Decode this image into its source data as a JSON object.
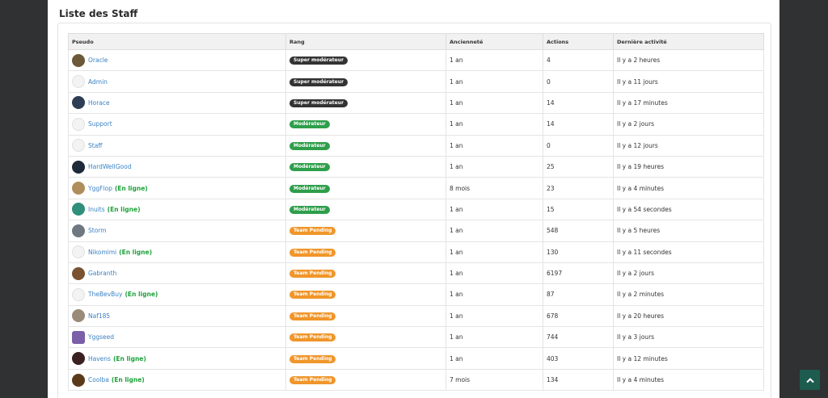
{
  "page": {
    "title": "Liste des Staff"
  },
  "table": {
    "headers": [
      "Pseudo",
      "Rang",
      "Ancienneté",
      "Actions",
      "Dernière activité"
    ],
    "online_label": "(En ligne)",
    "rows": [
      {
        "name": "Oracle",
        "online": false,
        "rank": "Super modérateur",
        "rank_color": "#333333",
        "seniority": "1 an",
        "actions": "4",
        "last": "Il y a 2 heures",
        "avatar": "#6b5a3a",
        "avatar_style": "round"
      },
      {
        "name": "Admin",
        "online": false,
        "rank": "Super modérateur",
        "rank_color": "#333333",
        "seniority": "1 an",
        "actions": "0",
        "last": "Il y a 11 jours",
        "avatar": "default",
        "avatar_style": "round"
      },
      {
        "name": "Horace",
        "online": false,
        "rank": "Super modérateur",
        "rank_color": "#333333",
        "seniority": "1 an",
        "actions": "14",
        "last": "Il y a 17 minutes",
        "avatar": "#2d3e55",
        "avatar_style": "round"
      },
      {
        "name": "Support",
        "online": false,
        "rank": "Modérateur",
        "rank_color": "#2e9e4a",
        "seniority": "1 an",
        "actions": "14",
        "last": "Il y a 2 jours",
        "avatar": "default",
        "avatar_style": "round"
      },
      {
        "name": "Staff",
        "online": false,
        "rank": "Modérateur",
        "rank_color": "#2e9e4a",
        "seniority": "1 an",
        "actions": "0",
        "last": "Il y a 12 jours",
        "avatar": "default",
        "avatar_style": "round"
      },
      {
        "name": "HardWellGood",
        "online": false,
        "rank": "Modérateur",
        "rank_color": "#2e9e4a",
        "seniority": "1 an",
        "actions": "25",
        "last": "Il y a 19 heures",
        "avatar": "#1d2a3a",
        "avatar_style": "round"
      },
      {
        "name": "YggFlop",
        "online": true,
        "rank": "Modérateur",
        "rank_color": "#2e9e4a",
        "seniority": "8 mois",
        "actions": "23",
        "last": "Il y a 4 minutes",
        "avatar": "#b08d5c",
        "avatar_style": "round"
      },
      {
        "name": "Inuits",
        "online": true,
        "rank": "Modérateur",
        "rank_color": "#2e9e4a",
        "seniority": "1 an",
        "actions": "15",
        "last": "Il y a 54 secondes",
        "avatar": "#2f8f7a",
        "avatar_style": "round"
      },
      {
        "name": "Storm",
        "online": false,
        "rank": "Team Pending",
        "rank_color": "#f0962a",
        "seniority": "1 an",
        "actions": "548",
        "last": "Il y a 5 heures",
        "avatar": "#6f7780",
        "avatar_style": "round"
      },
      {
        "name": "Nikomimi",
        "online": true,
        "rank": "Team Pending",
        "rank_color": "#f0962a",
        "seniority": "1 an",
        "actions": "130",
        "last": "Il y a 11 secondes",
        "avatar": "default",
        "avatar_style": "round"
      },
      {
        "name": "Gabranth",
        "online": false,
        "rank": "Team Pending",
        "rank_color": "#f0962a",
        "seniority": "1 an",
        "actions": "6197",
        "last": "Il y a 2 jours",
        "avatar": "#7a5230",
        "avatar_style": "round"
      },
      {
        "name": "TheBevBuy",
        "online": true,
        "rank": "Team Pending",
        "rank_color": "#f0962a",
        "seniority": "1 an",
        "actions": "87",
        "last": "Il y a 2 minutes",
        "avatar": "default",
        "avatar_style": "round"
      },
      {
        "name": "Naf185",
        "online": false,
        "rank": "Team Pending",
        "rank_color": "#f0962a",
        "seniority": "1 an",
        "actions": "678",
        "last": "Il y a 20 heures",
        "avatar": "#9a8a7a",
        "avatar_style": "round"
      },
      {
        "name": "Yggseed",
        "online": false,
        "rank": "Team Pending",
        "rank_color": "#f0962a",
        "seniority": "1 an",
        "actions": "744",
        "last": "Il y a 3 jours",
        "avatar": "#7b5fa8",
        "avatar_style": "square"
      },
      {
        "name": "Havens",
        "online": true,
        "rank": "Team Pending",
        "rank_color": "#f0962a",
        "seniority": "1 an",
        "actions": "403",
        "last": "Il y a 12 minutes",
        "avatar": "#3a2020",
        "avatar_style": "round"
      },
      {
        "name": "Coolba",
        "online": true,
        "rank": "Team Pending",
        "rank_color": "#f0962a",
        "seniority": "7 mois",
        "actions": "134",
        "last": "Il y a 4 minutes",
        "avatar": "#5a3a1a",
        "avatar_style": "round"
      }
    ]
  }
}
